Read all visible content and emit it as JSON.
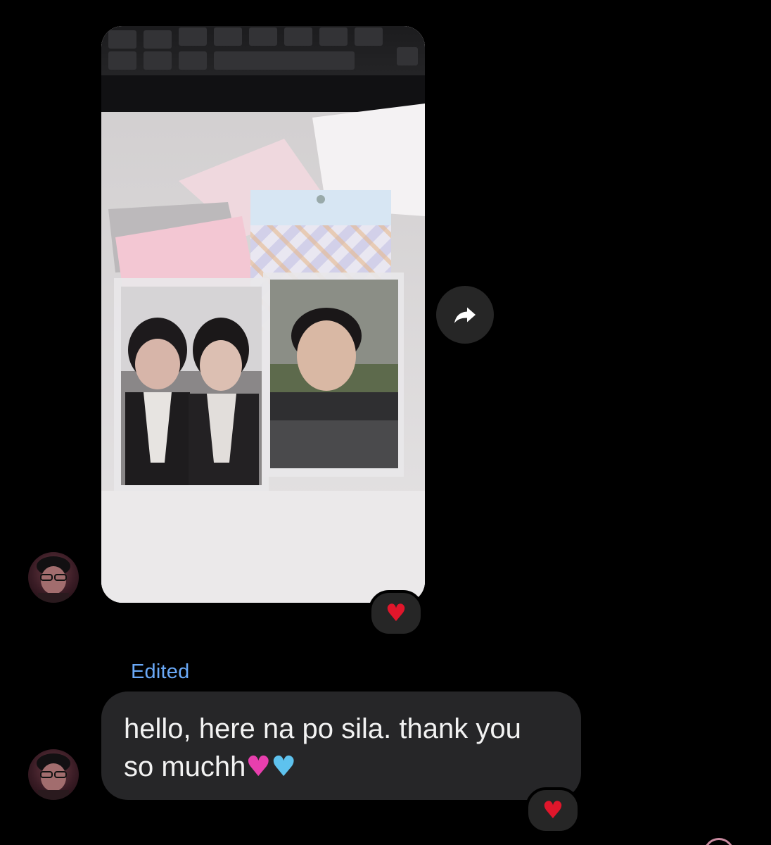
{
  "message": {
    "edited_label": "Edited",
    "text": "hello, here na po sila. thank you so muchh",
    "emoji_pink": "♥",
    "emoji_blue": "♥"
  },
  "reactions": {
    "photo": "♥",
    "text": "♥"
  },
  "colors": {
    "background": "#000000",
    "bubble": "#262628",
    "edited": "#6aa9f7",
    "reaction_heart": "#e0162b"
  },
  "icons": {
    "forward": "forward-arrow-icon",
    "avatar": "user-avatar"
  }
}
